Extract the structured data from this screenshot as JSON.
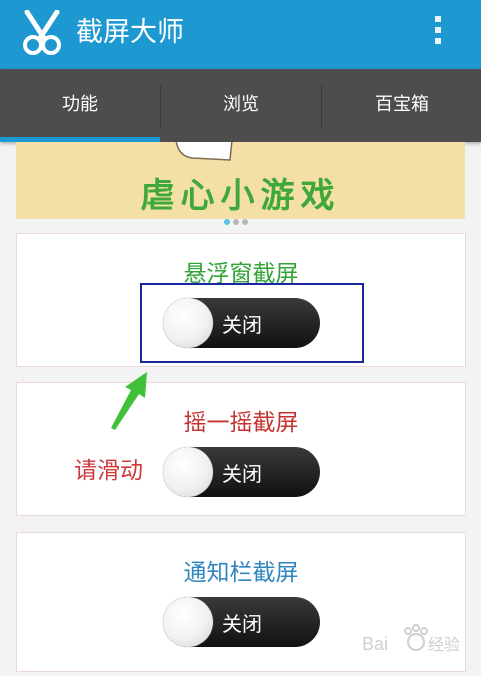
{
  "app": {
    "title": "截屏大师"
  },
  "tabs": [
    "功能",
    "浏览",
    "百宝箱"
  ],
  "banner": {
    "text": "虐心小游戏"
  },
  "features": [
    {
      "title": "悬浮窗截屏",
      "title_color": "#32a437",
      "toggle_label": "关闭",
      "enabled": false
    },
    {
      "title": "摇一摇截屏",
      "title_color": "#c4332f",
      "toggle_label": "关闭",
      "enabled": false
    },
    {
      "title": "通知栏截屏",
      "title_color": "#2f86c0",
      "toggle_label": "关闭",
      "enabled": false
    }
  ],
  "annotation": {
    "hint": "请滑动"
  },
  "watermark": {
    "text": "Baidu经验"
  },
  "colors": {
    "appbar": "#1d98d1",
    "tabbar": "#4d4d4d",
    "indicator": "#1b9ad6",
    "highlight": "#1a27a0",
    "arrow": "#3fc23a"
  }
}
